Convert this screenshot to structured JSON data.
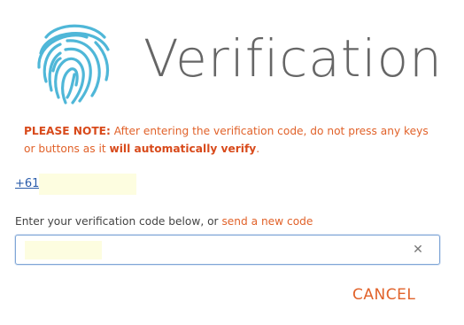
{
  "header": {
    "title": "Verification",
    "icon": "fingerprint-icon",
    "icon_color": "#4fb7d8"
  },
  "note": {
    "prefix": "PLEASE NOTE:",
    "text": " After entering the verification code, do not press any keys or buttons as it ",
    "emphasis": "will automatically verify",
    "suffix": "."
  },
  "phone": {
    "visible_text": "+61"
  },
  "instructions": {
    "text": "Enter your verification code below, or ",
    "link": "send a new code"
  },
  "code_input": {
    "value": "",
    "clear_icon": "close-icon"
  },
  "actions": {
    "cancel_label": "CANCEL"
  },
  "colors": {
    "accent": "#e1622a",
    "link": "#2a5caa",
    "input_border": "#7fa6d6",
    "redaction": "#fdfde0"
  }
}
